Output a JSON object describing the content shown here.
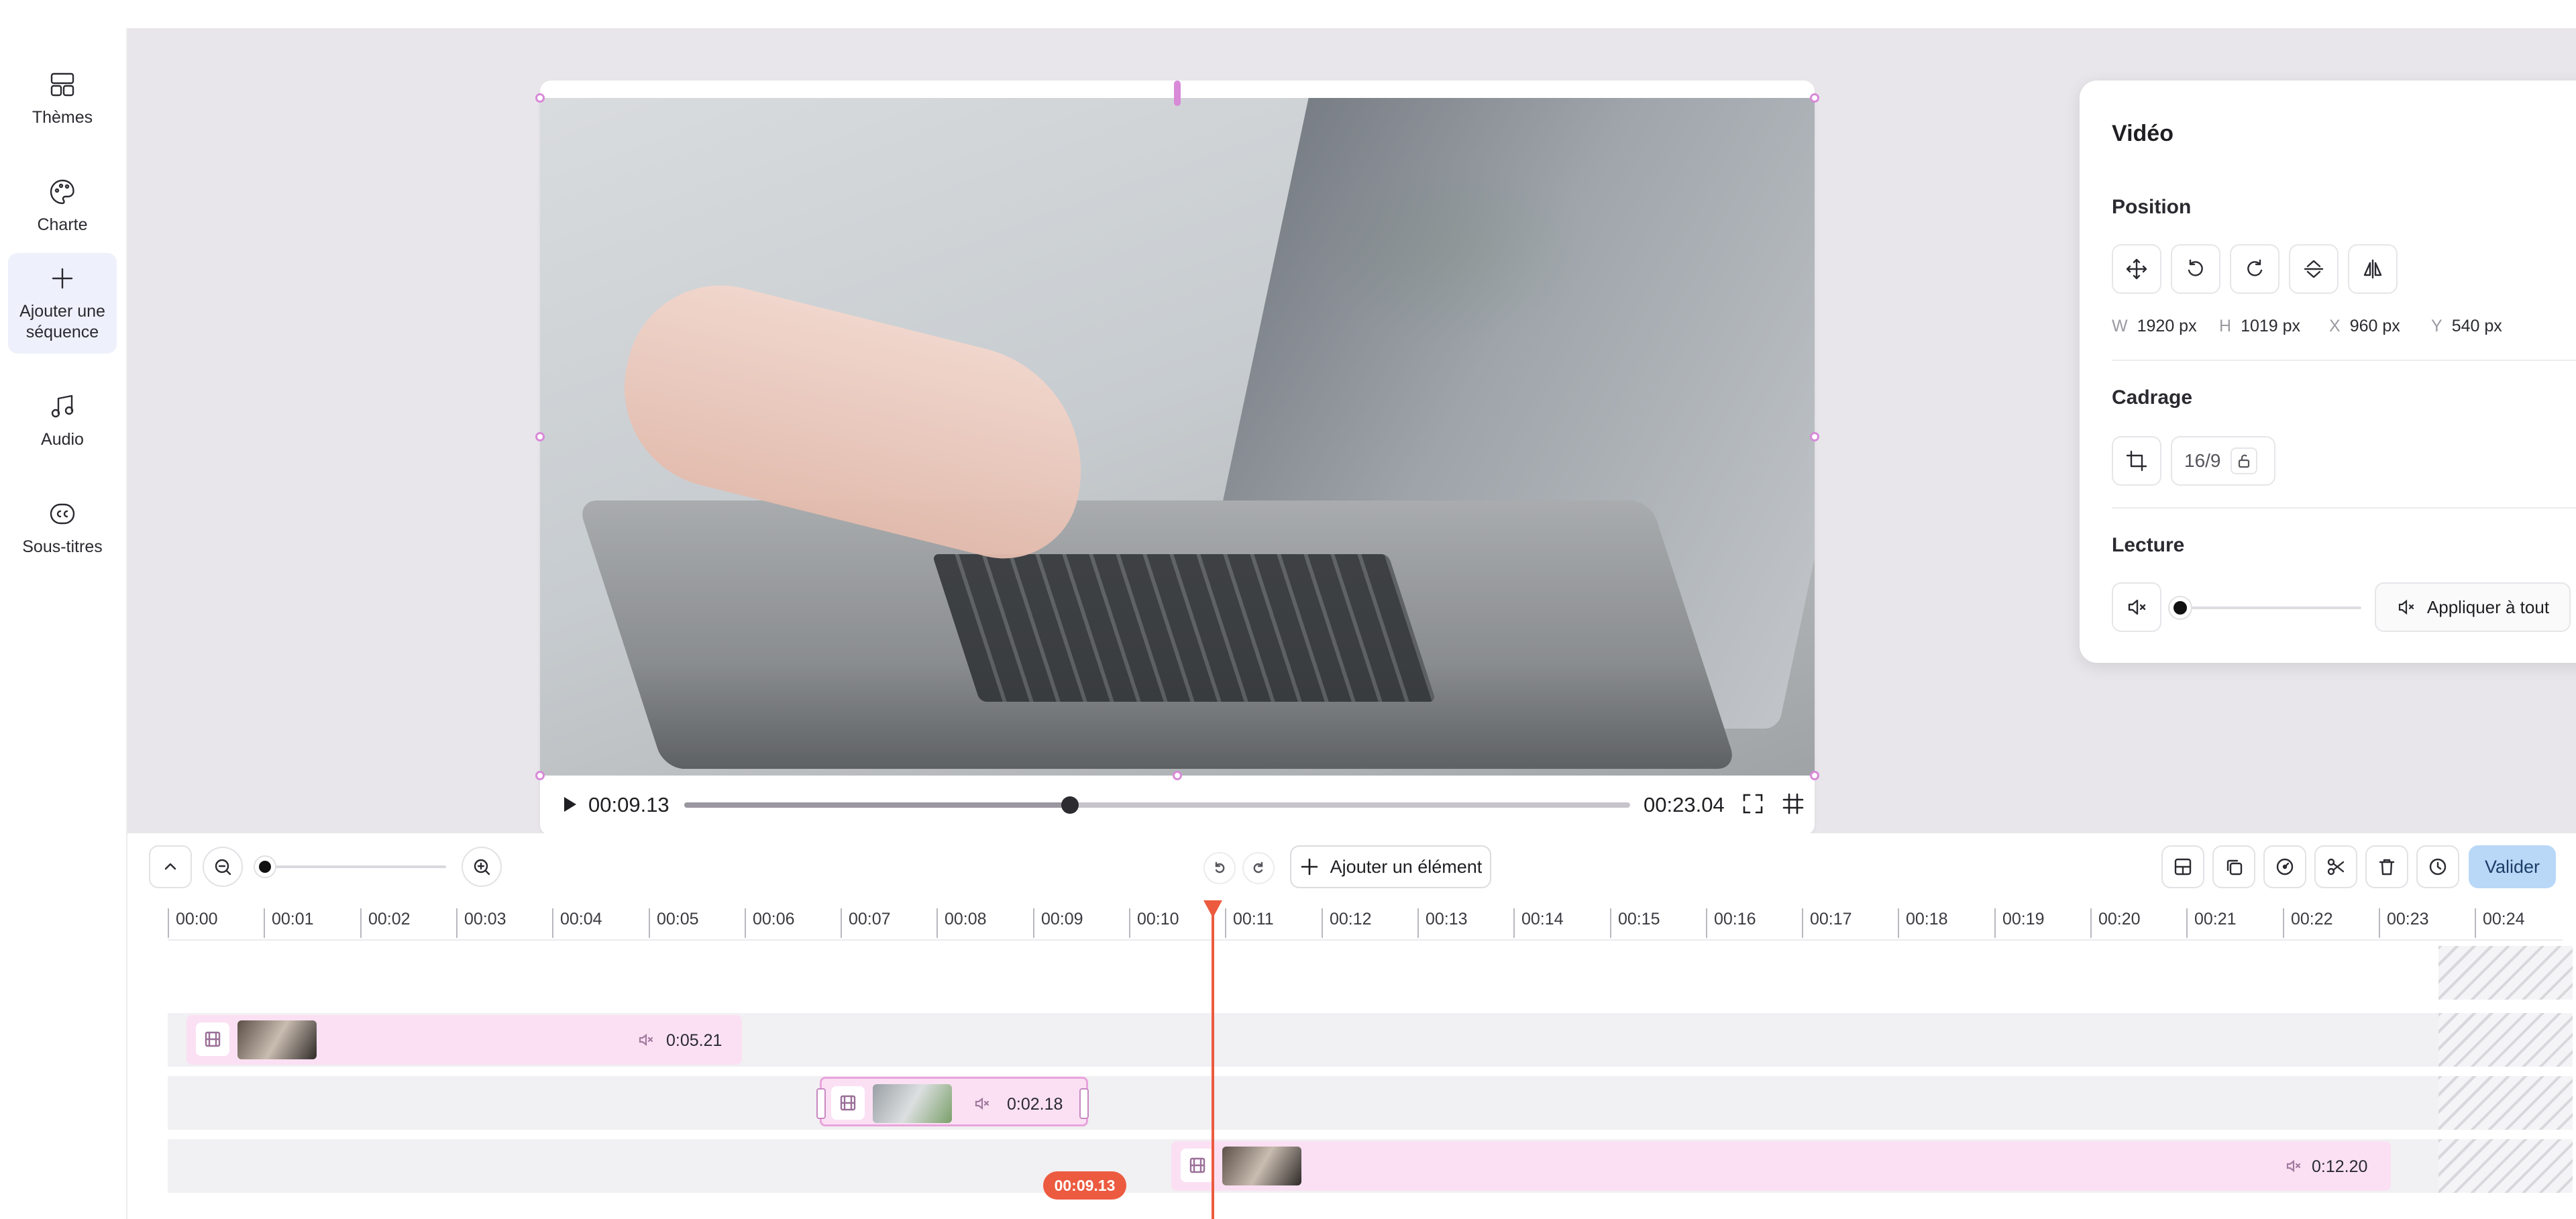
{
  "sidebar": {
    "items": [
      {
        "label": "Thèmes",
        "icon": "layout-icon"
      },
      {
        "label": "Charte",
        "icon": "palette-icon"
      },
      {
        "label": "Ajouter une séquence",
        "icon": "plus-icon",
        "active": true
      },
      {
        "label": "Audio",
        "icon": "music-note-icon"
      },
      {
        "label": "Sous-titres",
        "icon": "closed-captions-icon"
      }
    ]
  },
  "player": {
    "current_time": "00:09.13",
    "total_time": "00:23.04",
    "progress_fraction": 0.408
  },
  "panel": {
    "title": "Vidéo",
    "position": {
      "title": "Position",
      "tools": [
        "move-icon",
        "rotate-left-icon",
        "rotate-right-icon",
        "flip-vertical-icon",
        "flip-horizontal-icon"
      ],
      "w_label": "W",
      "w_value": "1920 px",
      "h_label": "H",
      "h_value": "1019 px",
      "x_label": "X",
      "x_value": "960 px",
      "y_label": "Y",
      "y_value": "540 px"
    },
    "crop": {
      "title": "Cadrage",
      "ratio": "16/9"
    },
    "playback": {
      "title": "Lecture",
      "volume_fraction": 0.0,
      "apply_label": "Appliquer à tout"
    }
  },
  "timeline": {
    "add_element_label": "Ajouter un élément",
    "validate_label": "Valider",
    "zoom_fraction": 0.0,
    "ruler": [
      "00:00",
      "00:01",
      "00:02",
      "00:03",
      "00:04",
      "00:05",
      "00:06",
      "00:07",
      "00:08",
      "00:09",
      "00:10",
      "00:11",
      "00:12",
      "00:13",
      "00:14",
      "00:15",
      "00:16",
      "00:17",
      "00:18",
      "00:19",
      "00:20",
      "00:21",
      "00:22",
      "00:23",
      "00:24"
    ],
    "clips": [
      {
        "duration": "0:05.21"
      },
      {
        "duration": "0:02.18"
      },
      {
        "duration": "0:12.20"
      }
    ],
    "playhead_label": "00:09.13"
  },
  "colors": {
    "accent_pink": "#fbe0f4",
    "playhead": "#ec5a3f",
    "validate": "#b9d8f8"
  }
}
